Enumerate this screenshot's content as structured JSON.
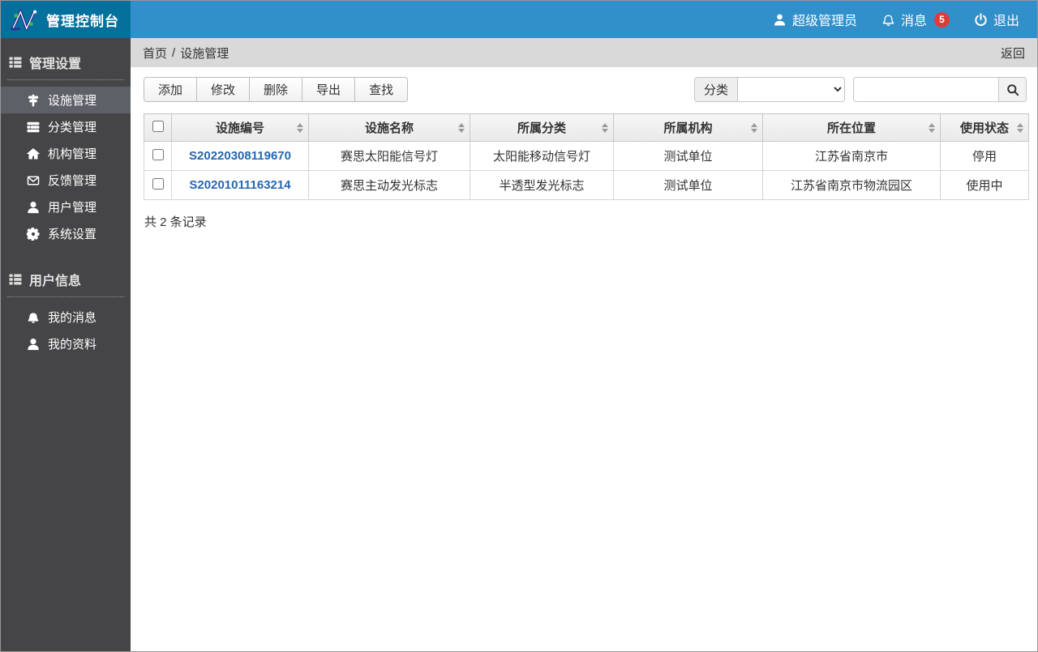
{
  "colors": {
    "topbar_blue": "#3190ca",
    "logo_teal": "#04719c",
    "sidebar_bg": "#454547",
    "sidebar_active": "#5d6167",
    "breadcrumb_bg": "#d9d9d9",
    "badge_red": "#e03b3b",
    "link_blue": "#2767ae"
  },
  "topbar": {
    "title": "管理控制台",
    "user": "超级管理员",
    "messages": "消息",
    "messages_badge": "5",
    "logout": "退出"
  },
  "sidebar": {
    "sections": [
      {
        "title": "管理设置",
        "items": [
          {
            "label": "设施管理",
            "icon": "signpost-icon",
            "active": true
          },
          {
            "label": "分类管理",
            "icon": "category-list-icon",
            "active": false
          },
          {
            "label": "机构管理",
            "icon": "home-icon",
            "active": false
          },
          {
            "label": "反馈管理",
            "icon": "envelope-icon",
            "active": false
          },
          {
            "label": "用户管理",
            "icon": "user-icon",
            "active": false
          },
          {
            "label": "系统设置",
            "icon": "gear-icon",
            "active": false
          }
        ]
      },
      {
        "title": "用户信息",
        "items": [
          {
            "label": "我的消息",
            "icon": "bell-icon",
            "active": false
          },
          {
            "label": "我的资料",
            "icon": "user-icon",
            "active": false
          }
        ]
      }
    ]
  },
  "breadcrumb": {
    "home": "首页",
    "separator": "/",
    "current": "设施管理",
    "back": "返回"
  },
  "toolbar": {
    "buttons": [
      "添加",
      "修改",
      "删除",
      "导出",
      "查找"
    ],
    "filter_label": "分类",
    "search_value": ""
  },
  "table": {
    "columns": [
      "设施编号",
      "设施名称",
      "所属分类",
      "所属机构",
      "所在位置",
      "使用状态"
    ],
    "rows": [
      {
        "id": "S20220308119670",
        "name": "赛思太阳能信号灯",
        "category": "太阳能移动信号灯",
        "org": "测试单位",
        "location": "江苏省南京市",
        "status": "停用"
      },
      {
        "id": "S20201011163214",
        "name": "赛思主动发光标志",
        "category": "半透型发光标志",
        "org": "测试单位",
        "location": "江苏省南京市物流园区",
        "status": "使用中"
      }
    ]
  },
  "footer": {
    "summary": "共 2 条记录"
  }
}
